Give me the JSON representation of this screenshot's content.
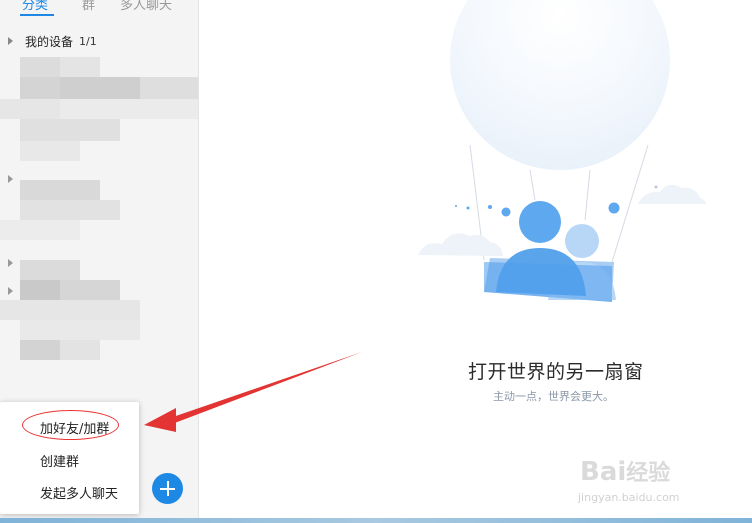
{
  "sidebar": {
    "tabs": [
      {
        "label": "分类"
      },
      {
        "label": "群"
      },
      {
        "label": "多人聊天"
      }
    ],
    "groups": [
      {
        "label": "我的设备",
        "count": "1/1"
      }
    ]
  },
  "main": {
    "title": "打开世界的另一扇窗",
    "subtitle": "主动一点，世界会更大。"
  },
  "popup_menu": {
    "items": [
      {
        "label": "加好友/加群"
      },
      {
        "label": "创建群"
      },
      {
        "label": "发起多人聊天"
      }
    ]
  },
  "plus_button": {
    "icon": "plus-icon"
  },
  "watermark": {
    "logo": "Baidu经验",
    "url": "jingyan.baidu.com"
  },
  "colors": {
    "accent": "#1e88e5",
    "annotation": "#e33333"
  }
}
